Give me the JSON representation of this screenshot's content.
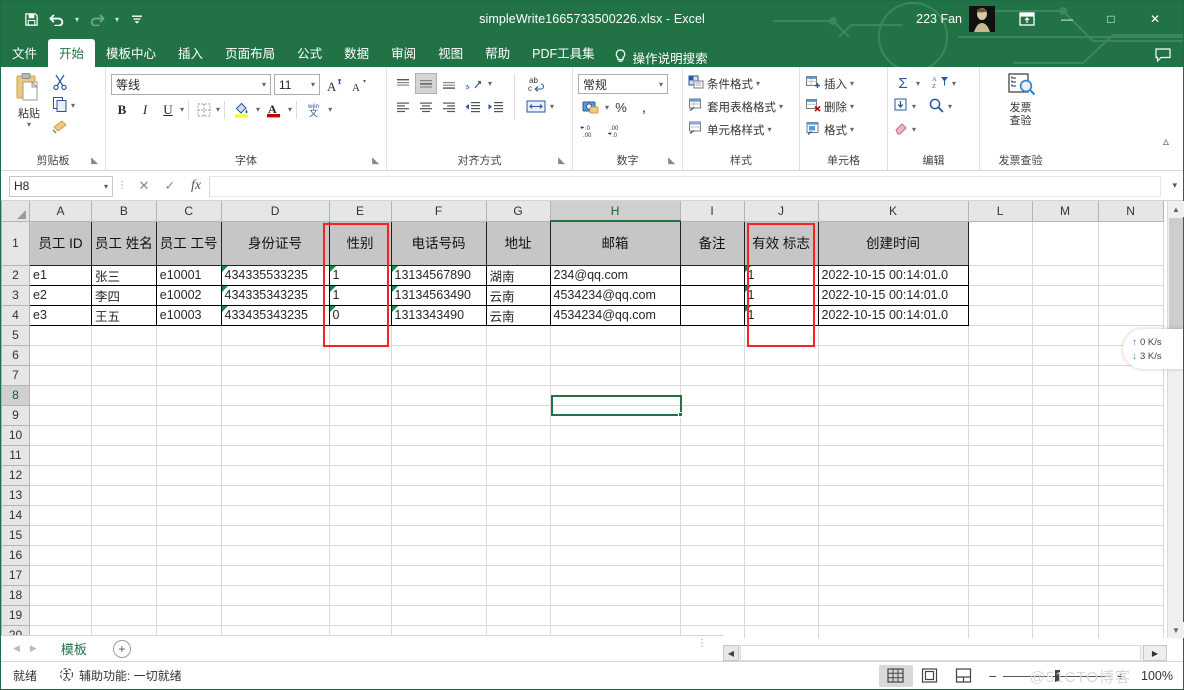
{
  "window": {
    "title": "simpleWrite1665733500226.xlsx  -  Excel",
    "account_name": "223 Fan",
    "minimize": "—",
    "maximize": "□",
    "close": "✕",
    "ribbon_display_icon": "ribbon-display-options-icon"
  },
  "quick_access": [
    {
      "name": "save",
      "icon": "save-icon"
    },
    {
      "name": "undo",
      "icon": "undo-icon"
    },
    {
      "name": "redo",
      "icon": "redo-icon"
    },
    {
      "name": "customize-quick-access-toolbar",
      "icon": "customize-qat-icon"
    }
  ],
  "menu_tabs": [
    {
      "label": "文件",
      "active": false
    },
    {
      "label": "开始",
      "active": true
    },
    {
      "label": "模板中心",
      "active": false
    },
    {
      "label": "插入",
      "active": false
    },
    {
      "label": "页面布局",
      "active": false
    },
    {
      "label": "公式",
      "active": false
    },
    {
      "label": "数据",
      "active": false
    },
    {
      "label": "审阅",
      "active": false
    },
    {
      "label": "视图",
      "active": false
    },
    {
      "label": "帮助",
      "active": false
    },
    {
      "label": "PDF工具集",
      "active": false
    }
  ],
  "tell_me": "操作说明搜索",
  "ribbon": {
    "clipboard": {
      "group_label": "剪贴板",
      "paste_label": "粘贴",
      "cut_name": "cut-icon",
      "copy_name": "copy-icon",
      "format_painter_name": "format-painter-icon"
    },
    "font": {
      "group_label": "字体",
      "font_name": "等线",
      "font_size": "11",
      "grow_font": "A",
      "shrink_font": "A",
      "bold": "B",
      "italic": "I",
      "underline": "U",
      "phonetic": "文"
    },
    "alignment": {
      "group_label": "对齐方式",
      "wrap_text_name": "wrap-text-icon",
      "merge_center_name": "merge-and-center-icon"
    },
    "number": {
      "group_label": "数字",
      "format_value": "常规",
      "percent": "%",
      "comma": ",",
      "increase_decimal": ".00",
      "decrease_decimal": ".00"
    },
    "styles": {
      "group_label": "样式",
      "items": [
        {
          "label": "条件格式",
          "icon": "conditional-formatting-icon"
        },
        {
          "label": "套用表格格式",
          "icon": "format-as-table-icon"
        },
        {
          "label": "单元格样式",
          "icon": "cell-styles-icon"
        }
      ]
    },
    "cells": {
      "group_label": "单元格",
      "items": [
        {
          "label": "插入",
          "icon": "insert-cells-icon"
        },
        {
          "label": "删除",
          "icon": "delete-cells-icon"
        },
        {
          "label": "格式",
          "icon": "format-cells-icon"
        }
      ]
    },
    "editing": {
      "group_label": "编辑",
      "autosum": "Σ",
      "fill_name": "fill-icon",
      "clear_name": "clear-icon",
      "sort_filter_name": "sort-and-filter-icon",
      "find_select_name": "find-and-select-icon"
    },
    "invoice": {
      "group_label": "发票查验",
      "button_line1": "发票",
      "button_line2": "查验",
      "icon": "invoice-check-icon"
    },
    "collapse_ribbon": "collapse-ribbon-icon"
  },
  "formula_bar": {
    "name_box_value": "H8",
    "cancel_icon": "cancel-icon",
    "enter_icon": "enter-icon",
    "function_icon": "fx",
    "formula_value": "",
    "expand_icon": "expand-formula-bar-icon"
  },
  "grid": {
    "column_headers": [
      "A",
      "B",
      "C",
      "D",
      "E",
      "F",
      "G",
      "H",
      "I",
      "J",
      "K",
      "L",
      "M",
      "N"
    ],
    "selected_column": "H",
    "selected_row": 8,
    "selected_cell": "H8",
    "row_numbers": [
      1,
      2,
      3,
      4,
      5,
      6,
      7,
      8,
      9,
      10,
      11,
      12,
      13,
      14,
      15,
      16,
      17,
      18,
      19,
      20
    ],
    "headers": [
      "员工 ID",
      "员工 姓名",
      "员工 工号",
      "身份证号",
      "性别",
      "电话号码",
      "地址",
      "邮箱",
      "备注",
      "有效 标志",
      "创建时间"
    ],
    "rows": [
      {
        "row": 2,
        "cells": [
          "e1",
          "张三",
          "e10001",
          "434335533235",
          "1",
          "13134567890",
          "湖南",
          "234@qq.com",
          "",
          "1",
          "2022-10-15 00:14:01.0"
        ]
      },
      {
        "row": 3,
        "cells": [
          "e2",
          "李四",
          "e10002",
          "434335343235",
          "1",
          "13134563490",
          "云南",
          "4534234@qq.com",
          "",
          "1",
          "2022-10-15 00:14:01.0"
        ]
      },
      {
        "row": 4,
        "cells": [
          "e3",
          "王五",
          "e10003",
          "433435343235",
          "0",
          "1313343490",
          "云南",
          "4534234@qq.com",
          "",
          "1",
          "2022-10-15 00:14:01.0"
        ]
      }
    ],
    "highlight_color": "#fc2121",
    "highlighted_columns": [
      "E",
      "J"
    ]
  },
  "sheet_tabs": {
    "tabs": [
      {
        "label": "模板",
        "active": true
      }
    ],
    "add_sheet": "+",
    "prev_icon": "previous-sheet-icon",
    "next_icon": "next-sheet-icon"
  },
  "status_bar": {
    "mode": "就绪",
    "accessibility": "辅助功能: 一切就绪",
    "views": [
      {
        "name": "normal-view",
        "icon": "grid-icon",
        "active": true
      },
      {
        "name": "page-layout-view",
        "icon": "page-layout-icon",
        "active": false
      },
      {
        "name": "page-break-view",
        "icon": "page-break-icon",
        "active": false
      }
    ],
    "zoom_out": "−",
    "zoom_in": "+",
    "zoom_value": "100%"
  },
  "watermark": "@51CTO博客",
  "net_speed": {
    "upload": "0   K/s",
    "download": "3   K/s",
    "up_arrow": "↑",
    "down_arrow": "↓"
  }
}
